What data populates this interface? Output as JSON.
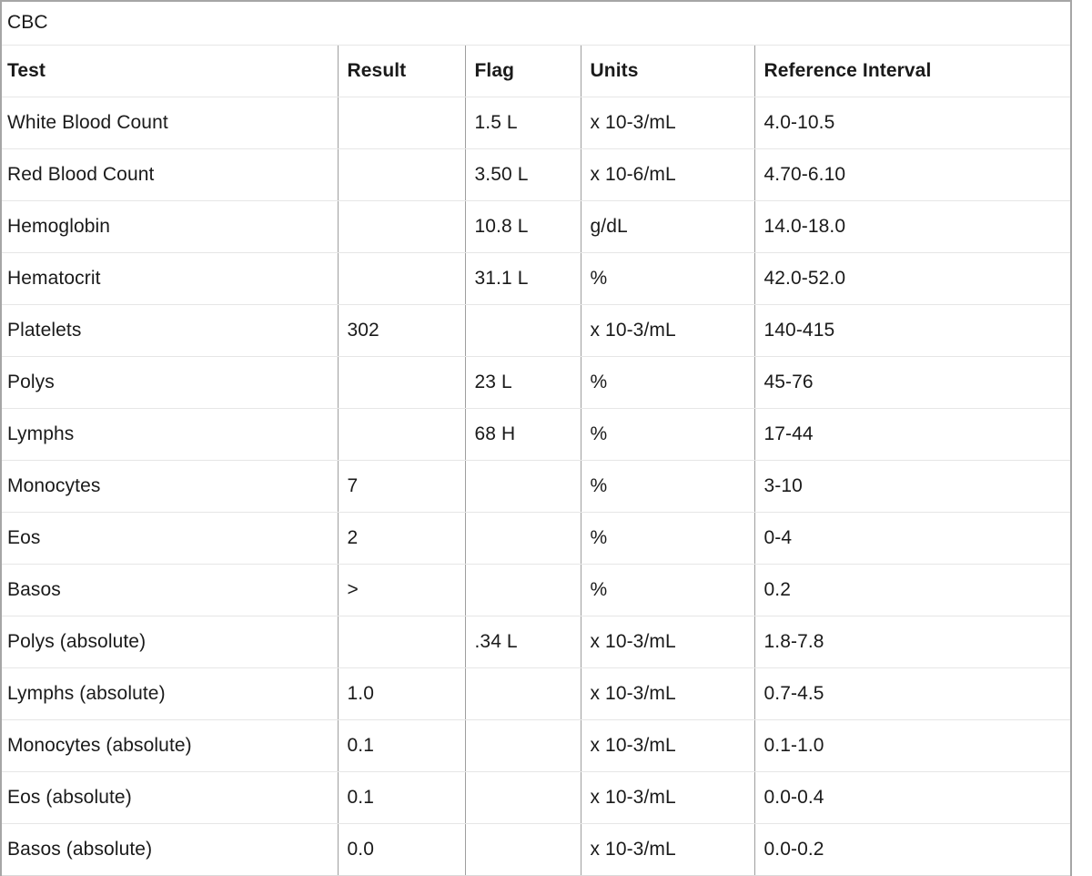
{
  "panel": {
    "title": "CBC"
  },
  "table": {
    "columns": [
      {
        "key": "test",
        "label": "Test"
      },
      {
        "key": "result",
        "label": "Result"
      },
      {
        "key": "flag",
        "label": "Flag"
      },
      {
        "key": "units",
        "label": "Units"
      },
      {
        "key": "ref",
        "label": "Reference Interval"
      }
    ],
    "rows": [
      {
        "test": "White Blood Count",
        "result": "",
        "flag": "1.5 L",
        "units": "x 10-3/mL",
        "ref": "4.0-10.5"
      },
      {
        "test": "Red Blood Count",
        "result": "",
        "flag": "3.50 L",
        "units": "x 10-6/mL",
        "ref": "4.70-6.10"
      },
      {
        "test": "Hemoglobin",
        "result": "",
        "flag": "10.8 L",
        "units": "g/dL",
        "ref": "14.0-18.0"
      },
      {
        "test": "Hematocrit",
        "result": "",
        "flag": "31.1 L",
        "units": "%",
        "ref": "42.0-52.0"
      },
      {
        "test": "Platelets",
        "result": "302",
        "flag": "",
        "units": "x 10-3/mL",
        "ref": "140-415"
      },
      {
        "test": "Polys",
        "result": "",
        "flag": "23 L",
        "units": "%",
        "ref": "45-76"
      },
      {
        "test": "Lymphs",
        "result": "",
        "flag": "68 H",
        "units": "%",
        "ref": "17-44"
      },
      {
        "test": "Monocytes",
        "result": "7",
        "flag": "",
        "units": "%",
        "ref": "3-10"
      },
      {
        "test": "Eos",
        "result": "2",
        "flag": "",
        "units": "%",
        "ref": "0-4"
      },
      {
        "test": "Basos",
        "result": ">",
        "flag": "",
        "units": "%",
        "ref": "0.2"
      },
      {
        "test": "Polys (absolute)",
        "result": "",
        "flag": ".34 L",
        "units": "x 10-3/mL",
        "ref": "1.8-7.8"
      },
      {
        "test": "Lymphs (absolute)",
        "result": "1.0",
        "flag": "",
        "units": "x 10-3/mL",
        "ref": "0.7-4.5"
      },
      {
        "test": "Monocytes (absolute)",
        "result": "0.1",
        "flag": "",
        "units": "x 10-3/mL",
        "ref": "0.1-1.0"
      },
      {
        "test": "Eos (absolute)",
        "result": "0.1",
        "flag": "",
        "units": "x 10-3/mL",
        "ref": "0.0-0.4"
      },
      {
        "test": "Basos (absolute)",
        "result": "0.0",
        "flag": "",
        "units": "x 10-3/mL",
        "ref": "0.0-0.2"
      }
    ]
  },
  "colors": {
    "text": "#1a1a1a",
    "outer_border": "#a6a6a6",
    "column_divider": "#9e9e9e",
    "row_divider": "#e6e6e6",
    "background": "#ffffff"
  }
}
